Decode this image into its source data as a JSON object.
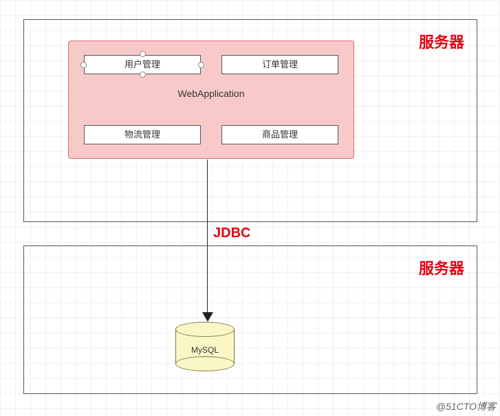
{
  "servers": {
    "top_label": "服务器",
    "bottom_label": "服务器"
  },
  "webapp": {
    "title": "WebApplication",
    "modules": {
      "user": "用户管理",
      "order": "订单管理",
      "logistics": "物流管理",
      "product": "商品管理"
    }
  },
  "connection": {
    "label": "JDBC"
  },
  "database": {
    "name": "MySQL"
  },
  "watermark": "@51CTO博客"
}
